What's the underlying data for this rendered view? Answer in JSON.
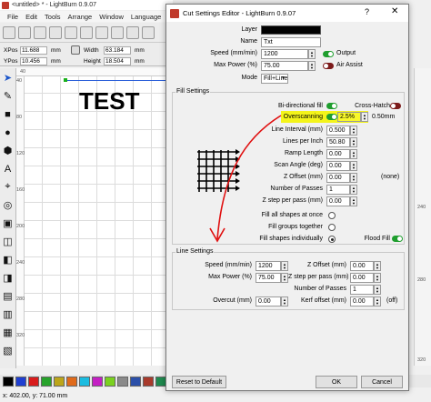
{
  "app": {
    "title": "<untitled> * - LightBurn 0.9.07",
    "menu": [
      "File",
      "Edit",
      "Tools",
      "Arrange",
      "Window",
      "Language"
    ],
    "xpos_label": "XPos",
    "xpos_value": "11.688",
    "ypos_label": "YPos",
    "ypos_value": "10.456",
    "width_label": "Width",
    "width_value": "63.184",
    "height_label": "Height",
    "height_value": "18.504",
    "unit": "mm",
    "canvas_text": "TEST",
    "ruler_top_40": "40",
    "ruler_left": [
      "40",
      "80",
      "120",
      "160",
      "200",
      "240",
      "280",
      "320"
    ],
    "ruler_right": [
      "240",
      "280",
      "320"
    ],
    "status": "x: 402.00, y: 71.00 mm",
    "palette": [
      "#000000",
      "#1f3fd1",
      "#d91c1c",
      "#27a32b",
      "#bca51a",
      "#e06a1a",
      "#1bbce0",
      "#c41fc4",
      "#7ad11f",
      "#8a8a8a",
      "#2b4fa8",
      "#a83a2b",
      "#1f8a4f",
      "#6a3ea8",
      "#d1a07a",
      "#a8a81f"
    ]
  },
  "dialog": {
    "title": "Cut Settings Editor - LightBurn 0.9.07",
    "help": "?",
    "close": "✕",
    "layer_label": "Layer",
    "name_label": "Name",
    "name_value": "Txt",
    "speed_label": "Speed (mm/min)",
    "speed_value": "1200",
    "output_label": "Output",
    "maxpower_label": "Max Power (%)",
    "maxpower_value": "75.00",
    "airassist_label": "Air Assist",
    "mode_label": "Mode",
    "mode_value": "Fill+Line",
    "fill_settings": {
      "title": "Fill Settings",
      "bidirectional_label": "Bi-directional fill",
      "crosshatch_label": "Cross-Hatch",
      "overscanning_label": "Overscanning",
      "overscanning_value": "2.5%",
      "overscanning_mm": "0.50mm",
      "line_interval_label": "Line Interval (mm)",
      "line_interval_value": "0.500",
      "lpi_label": "Lines per Inch",
      "lpi_value": "50.80",
      "ramp_label": "Ramp Length",
      "ramp_value": "0.00",
      "scan_angle_label": "Scan Angle (deg)",
      "scan_angle_value": "0.00",
      "zoffset_label": "Z Offset (mm)",
      "zoffset_value": "0.00",
      "zoffset_extra": "(none)",
      "passes_label": "Number of Passes",
      "passes_value": "1",
      "zstep_label": "Z step per pass (mm)",
      "zstep_value": "0.00",
      "fill_all_label": "Fill all shapes at once",
      "fill_groups_label": "Fill groups together",
      "fill_individually_label": "Fill shapes individually",
      "flood_fill_label": "Flood Fill"
    },
    "line_settings": {
      "title": "Line Settings",
      "speed_label": "Speed (mm/min)",
      "speed_value": "1200",
      "zoffset_label": "Z Offset (mm)",
      "zoffset_value": "0.00",
      "maxpower_label": "Max Power (%)",
      "maxpower_value": "75.00",
      "zstep_label": "Z step per pass (mm)",
      "zstep_value": "0.00",
      "passes_label": "Number of Passes",
      "passes_value": "1",
      "overcut_label": "Overcut (mm)",
      "overcut_value": "0.00",
      "kerf_label": "Kerf offset (mm)",
      "kerf_value": "0.00",
      "kerf_extra": "(off)"
    },
    "reset_label": "Reset to Default",
    "ok_label": "OK",
    "cancel_label": "Cancel"
  }
}
